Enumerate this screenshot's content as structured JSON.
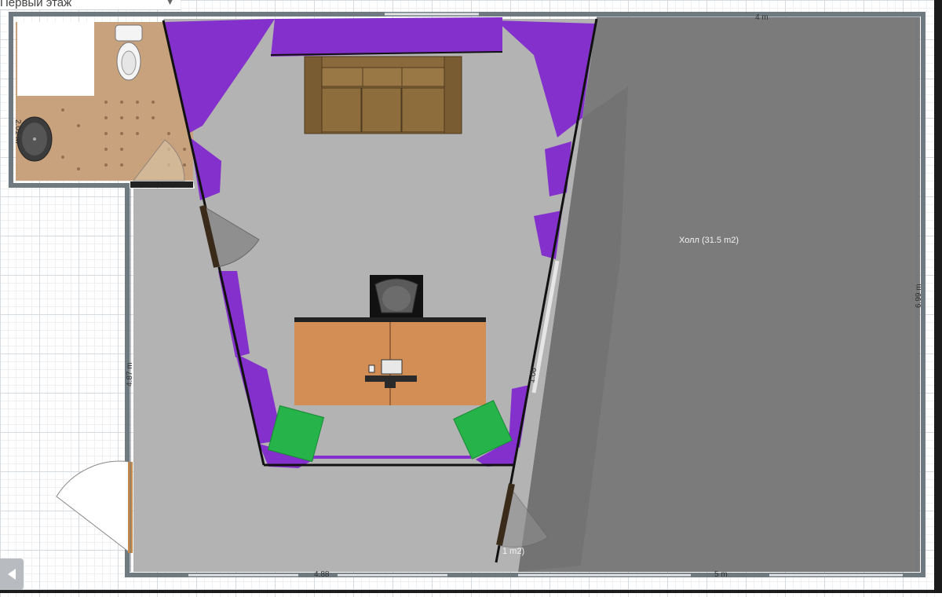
{
  "floor_selector": {
    "label": "Первый этаж"
  },
  "rooms": {
    "hall": {
      "label": "Холл (31.5 m2)"
    },
    "small_tag": {
      "label": "1 m2)"
    }
  },
  "dimensions": {
    "top_right": "4 m",
    "right": "6.99 m",
    "bathroom_left": "2.01 m",
    "left": "4.87 m",
    "bottom_left": "4.88",
    "bottom_right": "5 m",
    "diagonal": "1.06"
  },
  "icons": {
    "scroll_left": "chevron-left-icon",
    "toilet": "toilet-icon",
    "sink": "sink-icon",
    "sofa": "sofa-icon",
    "chair": "chair-icon",
    "desk": "desk-icon",
    "computer": "computer-icon"
  },
  "colors": {
    "hall_floor": "#7b7b7b",
    "office_floor": "#b3b3b3",
    "bathroom_floor": "#c8a27c",
    "drapes": "#8430cc",
    "plants": "#25b34a",
    "desk": "#d38e55",
    "sofa": "#8a6a3c",
    "walls": "#6f7a80"
  }
}
